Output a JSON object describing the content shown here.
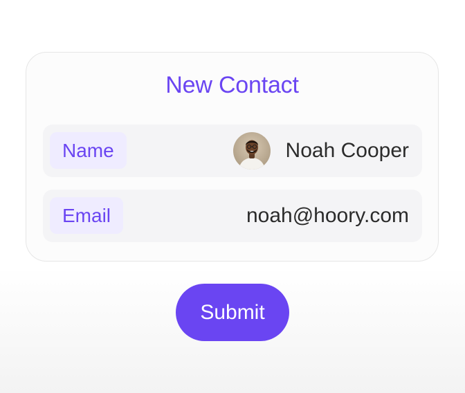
{
  "card": {
    "title": "New Contact",
    "fields": [
      {
        "label": "Name",
        "value": "Noah Cooper",
        "has_avatar": true
      },
      {
        "label": "Email",
        "value": "noah@hoory.com",
        "has_avatar": false
      }
    ]
  },
  "actions": {
    "submit_label": "Submit"
  },
  "colors": {
    "accent": "#6a45f2",
    "chip_background": "#efecff",
    "row_background": "#f4f4f6",
    "text": "#2b2b2b",
    "card_background": "#fcfcfc"
  },
  "icons": {
    "avatar": "contact-avatar-photo"
  }
}
